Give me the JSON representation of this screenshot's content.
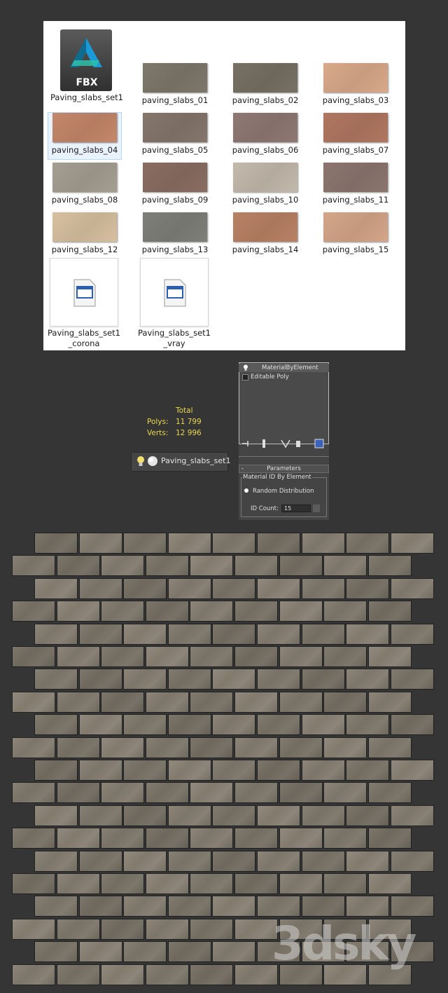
{
  "browser": {
    "fbx_file": {
      "label": "Paving_slabs_set1",
      "icon_text": "FBX"
    },
    "textures": [
      {
        "label": "paving_slabs_01",
        "color": "#7e786b"
      },
      {
        "label": "paving_slabs_02",
        "color": "#777063"
      },
      {
        "label": "paving_slabs_03",
        "color": "#d9a98a"
      },
      {
        "label": "paving_slabs_04",
        "color": "#c4876a"
      },
      {
        "label": "paving_slabs_05",
        "color": "#85766c"
      },
      {
        "label": "paving_slabs_06",
        "color": "#8f7874"
      },
      {
        "label": "paving_slabs_07",
        "color": "#b07761"
      },
      {
        "label": "paving_slabs_08",
        "color": "#a59e92"
      },
      {
        "label": "paving_slabs_09",
        "color": "#8a6d62"
      },
      {
        "label": "paving_slabs_10",
        "color": "#c3b9ac"
      },
      {
        "label": "paving_slabs_11",
        "color": "#8c756f"
      },
      {
        "label": "paving_slabs_12",
        "color": "#d7c0a0"
      },
      {
        "label": "paving_slabs_13",
        "color": "#7f7f79"
      },
      {
        "label": "paving_slabs_14",
        "color": "#b88165"
      },
      {
        "label": "paving_slabs_15",
        "color": "#d4a689"
      }
    ],
    "scene_files": [
      {
        "label_line1": "Paving_slabs_set1",
        "label_line2": "_corona"
      },
      {
        "label_line1": "Paving_slabs_set1",
        "label_line2": "_vray"
      }
    ]
  },
  "stats": {
    "header": "Total",
    "polys_label": "Polys:",
    "polys_value": "11 799",
    "verts_label": "Verts:",
    "verts_value": "12 996"
  },
  "layer": {
    "name": "Paving_slabs_set1"
  },
  "modifier_panel": {
    "modifier_name": "MaterialByElement",
    "base_object": "Editable Poly",
    "rollout_toggle": "-",
    "rollout_title": "Parameters",
    "group_title": "Material ID By Element",
    "radio_label": "Random Distribution",
    "id_count_label": "ID Count:",
    "id_count_value": "15"
  },
  "wall": {
    "brick_color": "#7e776b",
    "mortar_color": "#222222"
  },
  "watermark": "3dsky"
}
